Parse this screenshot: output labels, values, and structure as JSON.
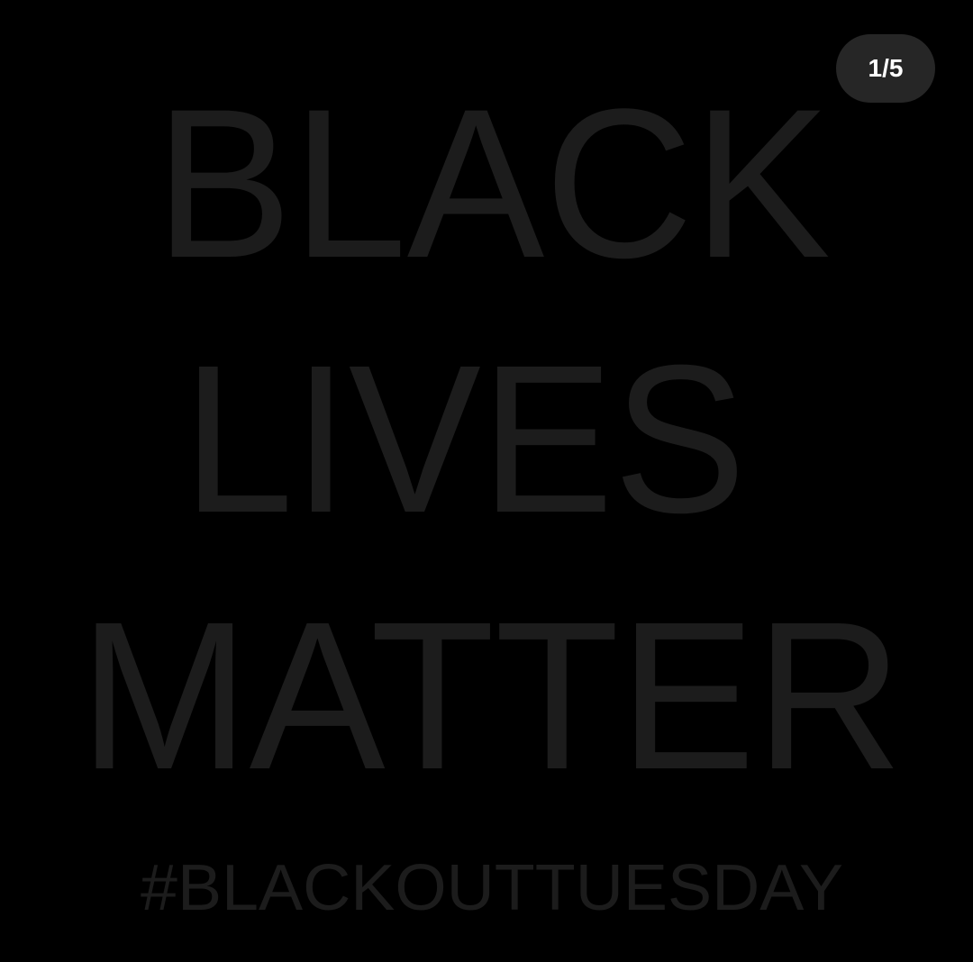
{
  "post": {
    "lines": [
      "BLACK",
      "LIVES",
      "MATTER"
    ],
    "hashtag": "#BLACKOUTTUESDAY",
    "text_color": "#1c1c1c",
    "background_color": "#000000"
  },
  "carousel": {
    "counter": "1/5",
    "current": 1,
    "total": 5
  }
}
